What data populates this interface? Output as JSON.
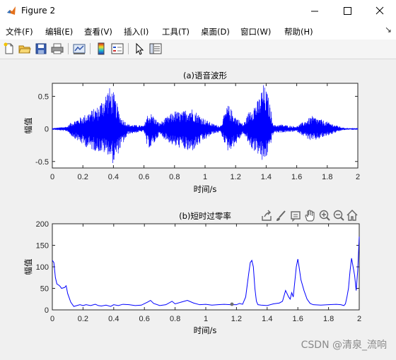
{
  "window": {
    "title": "Figure 2"
  },
  "menu": [
    "文件(F)",
    "编辑(E)",
    "查看(V)",
    "插入(I)",
    "工具(T)",
    "桌面(D)",
    "窗口(W)",
    "帮助(H)"
  ],
  "toolbar": {
    "buttons": [
      "new-figure-icon",
      "open-file-icon",
      "save-icon",
      "print-icon",
      "link-plot-icon",
      "colorbar-icon",
      "legend-icon",
      "edit-plot-arrow-icon",
      "property-inspector-icon"
    ]
  },
  "axes_toolbar": [
    "export-icon",
    "brush-icon",
    "data-tips-icon",
    "pan-icon",
    "zoom-in-icon",
    "zoom-out-icon",
    "home-icon"
  ],
  "chart_data": [
    {
      "type": "line",
      "title": "(a)语音波形",
      "xlabel": "时间/s",
      "ylabel": "幅值",
      "xlim": [
        0,
        2
      ],
      "ylim": [
        -0.6,
        0.7
      ],
      "xticks": [
        "0",
        "0.2",
        "0.4",
        "0.6",
        "0.8",
        "1",
        "1.2",
        "1.4",
        "1.6",
        "1.8",
        "2"
      ],
      "yticks": [
        "-0.5",
        "0",
        "0.5"
      ],
      "color": "#0000ff",
      "envelope": {
        "t": [
          0,
          0.1,
          0.12,
          0.2,
          0.25,
          0.3,
          0.37,
          0.4,
          0.45,
          0.5,
          0.6,
          0.62,
          0.65,
          0.7,
          0.8,
          0.85,
          0.9,
          1.0,
          1.05,
          1.1,
          1.15,
          1.2,
          1.25,
          1.3,
          1.35,
          1.38,
          1.41,
          1.45,
          1.5,
          1.55,
          1.6,
          1.7,
          1.8,
          1.9,
          1.95,
          2.0
        ],
        "upper": [
          0.01,
          0.04,
          0.1,
          0.2,
          0.28,
          0.35,
          0.65,
          0.57,
          0.18,
          0.07,
          0.05,
          0.22,
          0.24,
          0.09,
          0.28,
          0.26,
          0.35,
          0.15,
          0.08,
          0.05,
          0.38,
          0.2,
          0.07,
          0.34,
          0.45,
          0.7,
          0.55,
          0.06,
          0.07,
          0.05,
          0.04,
          0.2,
          0.11,
          0.02,
          0.01,
          0.01
        ],
        "lower": [
          -0.01,
          -0.04,
          -0.1,
          -0.25,
          -0.32,
          -0.35,
          -0.4,
          -0.55,
          -0.28,
          -0.08,
          -0.04,
          -0.28,
          -0.3,
          -0.09,
          -0.28,
          -0.3,
          -0.38,
          -0.17,
          -0.08,
          -0.05,
          -0.35,
          -0.25,
          -0.07,
          -0.3,
          -0.4,
          -0.55,
          -0.4,
          -0.06,
          -0.06,
          -0.05,
          -0.04,
          -0.2,
          -0.11,
          -0.02,
          -0.01,
          -0.01
        ]
      }
    },
    {
      "type": "line",
      "title": "(b)短时过零率",
      "xlabel": "时间/s",
      "ylabel": "幅值",
      "xlim": [
        0,
        2
      ],
      "ylim": [
        0,
        200
      ],
      "xticks": [
        "0",
        "0.2",
        "0.4",
        "0.6",
        "0.8",
        "1",
        "1.2",
        "1.4",
        "1.6",
        "1.8",
        "2"
      ],
      "yticks": [
        "0",
        "50",
        "100",
        "150",
        "200"
      ],
      "color": "#0000ff",
      "x": [
        0,
        0.01,
        0.02,
        0.03,
        0.04,
        0.05,
        0.06,
        0.08,
        0.09,
        0.1,
        0.12,
        0.14,
        0.16,
        0.18,
        0.2,
        0.22,
        0.25,
        0.28,
        0.3,
        0.32,
        0.35,
        0.38,
        0.4,
        0.43,
        0.46,
        0.5,
        0.54,
        0.58,
        0.62,
        0.64,
        0.66,
        0.7,
        0.74,
        0.78,
        0.8,
        0.84,
        0.88,
        0.92,
        0.96,
        1.0,
        1.04,
        1.08,
        1.12,
        1.16,
        1.2,
        1.22,
        1.24,
        1.26,
        1.28,
        1.29,
        1.3,
        1.31,
        1.32,
        1.33,
        1.34,
        1.36,
        1.4,
        1.44,
        1.48,
        1.5,
        1.52,
        1.54,
        1.55,
        1.56,
        1.57,
        1.58,
        1.59,
        1.6,
        1.61,
        1.62,
        1.64,
        1.66,
        1.68,
        1.7,
        1.75,
        1.8,
        1.85,
        1.88,
        1.9,
        1.91,
        1.92,
        1.93,
        1.94,
        1.95,
        1.96,
        1.97,
        1.98,
        1.99,
        2.0
      ],
      "y": [
        115,
        110,
        75,
        60,
        58,
        55,
        50,
        52,
        56,
        38,
        18,
        8,
        10,
        12,
        10,
        12,
        10,
        13,
        10,
        9,
        11,
        8,
        12,
        10,
        13,
        12,
        10,
        11,
        18,
        22,
        15,
        10,
        12,
        20,
        14,
        18,
        22,
        16,
        12,
        13,
        11,
        12,
        13,
        12,
        12,
        15,
        13,
        30,
        85,
        110,
        115,
        100,
        50,
        20,
        12,
        11,
        10,
        14,
        16,
        20,
        45,
        30,
        25,
        40,
        30,
        65,
        100,
        118,
        95,
        70,
        45,
        25,
        15,
        12,
        11,
        12,
        13,
        12,
        10,
        14,
        30,
        50,
        90,
        120,
        100,
        80,
        45,
        90,
        170
      ]
    }
  ],
  "watermark": "CSDN @清泉_流响"
}
